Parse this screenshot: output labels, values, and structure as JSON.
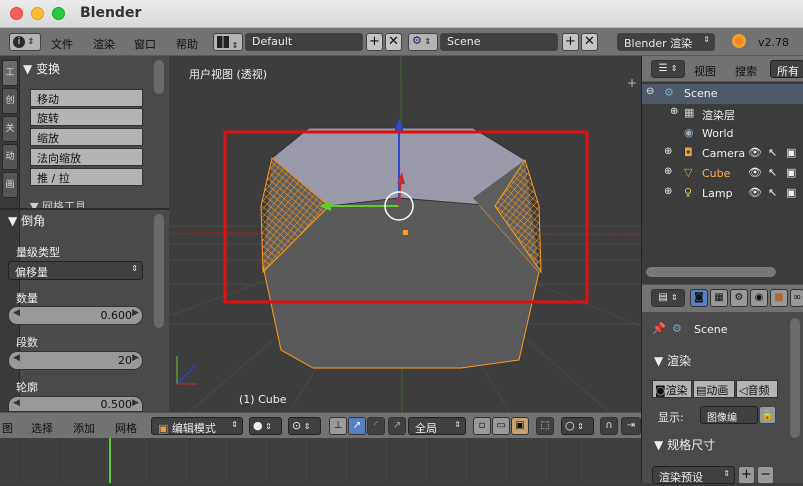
{
  "window": {
    "title": "Blender"
  },
  "topbar": {
    "menus": [
      "文件",
      "渲染",
      "窗口",
      "帮助"
    ],
    "layout": "Default",
    "scene": "Scene",
    "engine": "Blender 渲染",
    "version": "v2.78"
  },
  "toolshelf": {
    "tabs": [
      "工",
      "创",
      "关",
      "动",
      "画"
    ],
    "transform": {
      "title": "变换",
      "buttons": [
        "移动",
        "旋转",
        "缩放",
        "法向缩放",
        "推 / 拉"
      ]
    },
    "mesh_tools_title": "网格工具",
    "bevel": {
      "title": "倒角",
      "amount_type_label": "量级类型",
      "amount_type_value": "偏移量",
      "amount_label": "数量",
      "amount_value": "0.600",
      "segments_label": "段数",
      "segments_value": "20",
      "profile_label": "轮廓",
      "profile_value": "0.500"
    }
  },
  "viewport": {
    "view_label": "用户视图 (透视)",
    "object_label": "(1) Cube"
  },
  "outliner": {
    "header": {
      "view": "视图",
      "search": "搜索",
      "all": "所有"
    },
    "items": [
      {
        "label": "Scene",
        "indent": 0
      },
      {
        "label": "渲染层",
        "indent": 1
      },
      {
        "label": "World",
        "indent": 1
      },
      {
        "label": "Camera",
        "indent": 1
      },
      {
        "label": "Cube",
        "indent": 1
      },
      {
        "label": "Lamp",
        "indent": 1
      }
    ]
  },
  "properties": {
    "scene_name": "Scene",
    "render_title": "渲染",
    "render_btn": "渲染",
    "anim_btn": "动画",
    "audio_btn": "音频",
    "display_label": "显示:",
    "display_value": "图像编",
    "dimensions_title": "规格尺寸",
    "preset": "渲染预设"
  },
  "bottombar": {
    "menus": [
      "图",
      "选择",
      "添加",
      "网格"
    ],
    "mode": "编辑模式",
    "pivot": "全局"
  },
  "colors": {
    "selection_box": "#e01010",
    "bevel_orange": "#ff9a1a",
    "x_axis": "#cc2a2a",
    "y_axis": "#5fcc2a",
    "z_axis": "#2a4acc"
  }
}
